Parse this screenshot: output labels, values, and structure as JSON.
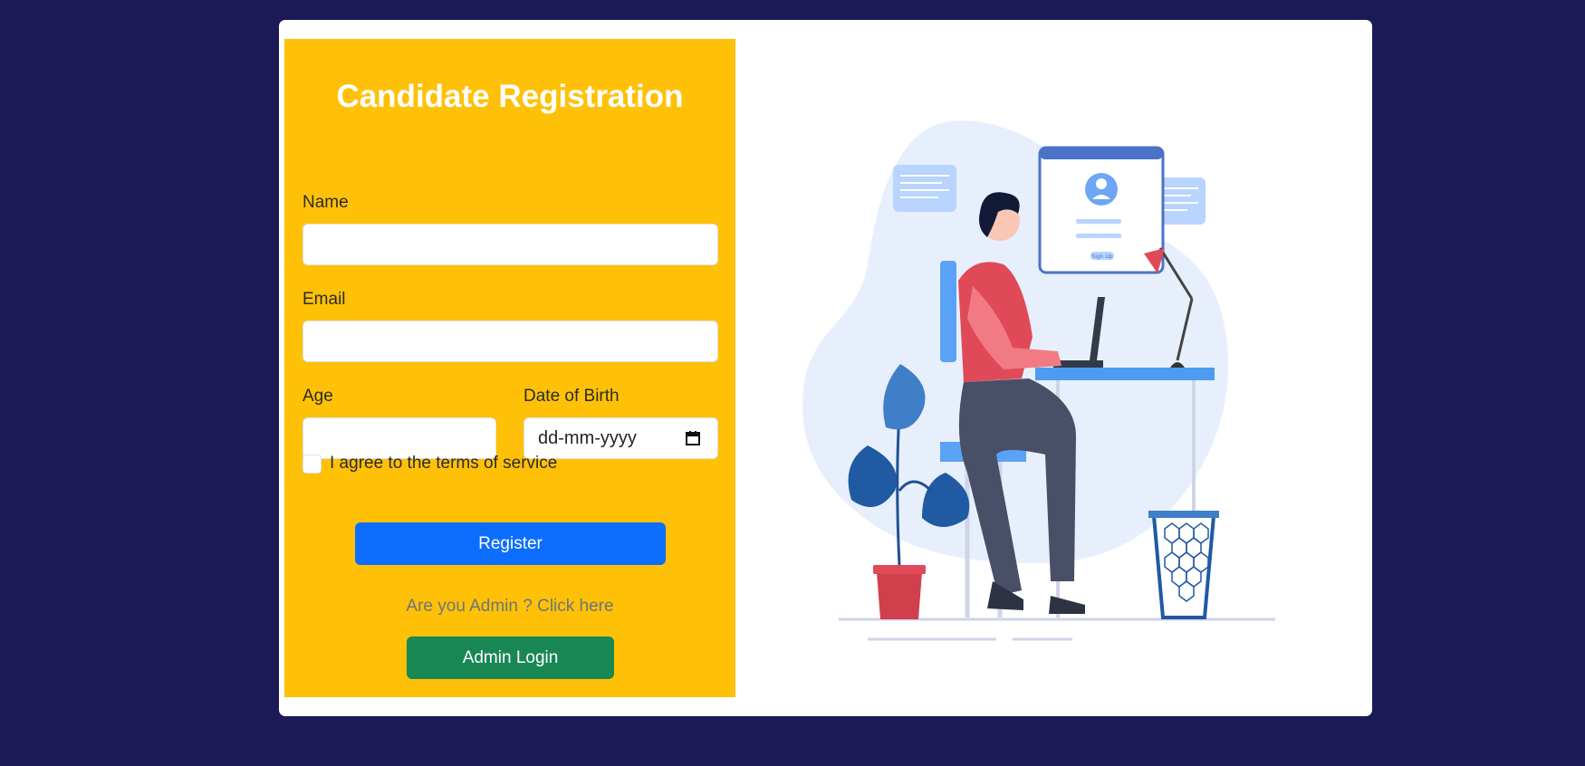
{
  "form": {
    "title": "Candidate Registration",
    "name_label": "Name",
    "name_value": "",
    "email_label": "Email",
    "email_value": "",
    "age_label": "Age",
    "age_value": "",
    "dob_label": "Date of Birth",
    "dob_placeholder": "dd-mm-yyyy",
    "terms_label": "I agree to the terms of service",
    "terms_checked": false,
    "register_label": "Register",
    "admin_prompt": "Are you Admin ? Click here",
    "admin_login_label": "Admin Login"
  },
  "illustration": {
    "signup_text": "Sign Up"
  },
  "colors": {
    "background": "#1c1a56",
    "panel": "#ffc107",
    "primary": "#0d6efd",
    "success": "#198754"
  }
}
